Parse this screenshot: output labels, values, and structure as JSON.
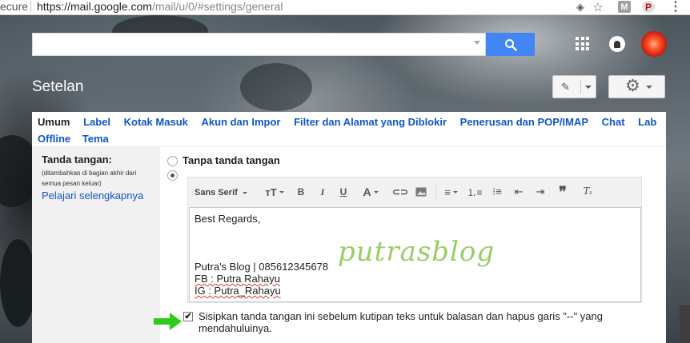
{
  "browser": {
    "secure_text": "ecure",
    "url_host": "https://mail.google.com",
    "url_path": "/mail/u/0/#settings/general",
    "ext_m": "M",
    "ext_p": "P"
  },
  "header": {
    "search_placeholder": "",
    "title": "Setelan"
  },
  "tabs": {
    "row1": [
      {
        "label": "Umum",
        "active": true
      },
      {
        "label": "Label"
      },
      {
        "label": "Kotak Masuk"
      },
      {
        "label": "Akun dan Impor"
      },
      {
        "label": "Filter dan Alamat yang Diblokir"
      },
      {
        "label": "Penerusan dan POP/IMAP"
      },
      {
        "label": "Chat"
      },
      {
        "label": "Lab"
      }
    ],
    "row2": [
      {
        "label": "Offline"
      },
      {
        "label": "Tema"
      }
    ]
  },
  "signature": {
    "label": "Tanda tangan:",
    "note": "(ditambahkan di bagian akhir dari semua pesan keluar)",
    "learn_more": "Pelajari selengkapnya",
    "no_signature_label": "Tanpa tanda tangan",
    "font_select": "Sans Serif",
    "body_lines": [
      "Best Regards,",
      "Putra's Blog | 085612345678",
      "FB : Putra Rahayu",
      "IG : Putra_Rahayu"
    ],
    "watermark": "putrasblog",
    "checkbox_checked": true,
    "checkbox_label": "Sisipkan tanda tangan ini sebelum kutipan teks untuk balasan dan hapus garis \"--\" yang mendahuluinya."
  },
  "toolbar_icons": [
    "text-size-icon",
    "bold-icon",
    "italic-icon",
    "underline-icon",
    "text-color-icon",
    "link-icon",
    "image-icon",
    "align-icon",
    "numbered-list-icon",
    "bulleted-list-icon",
    "indent-less-icon",
    "indent-more-icon",
    "quote-icon",
    "remove-formatting-icon"
  ],
  "colors": {
    "accent_blue": "#4285f4",
    "link_blue": "#1155cc",
    "arrow_green": "#2ecc1a",
    "watermark_green": "#9acd66"
  }
}
